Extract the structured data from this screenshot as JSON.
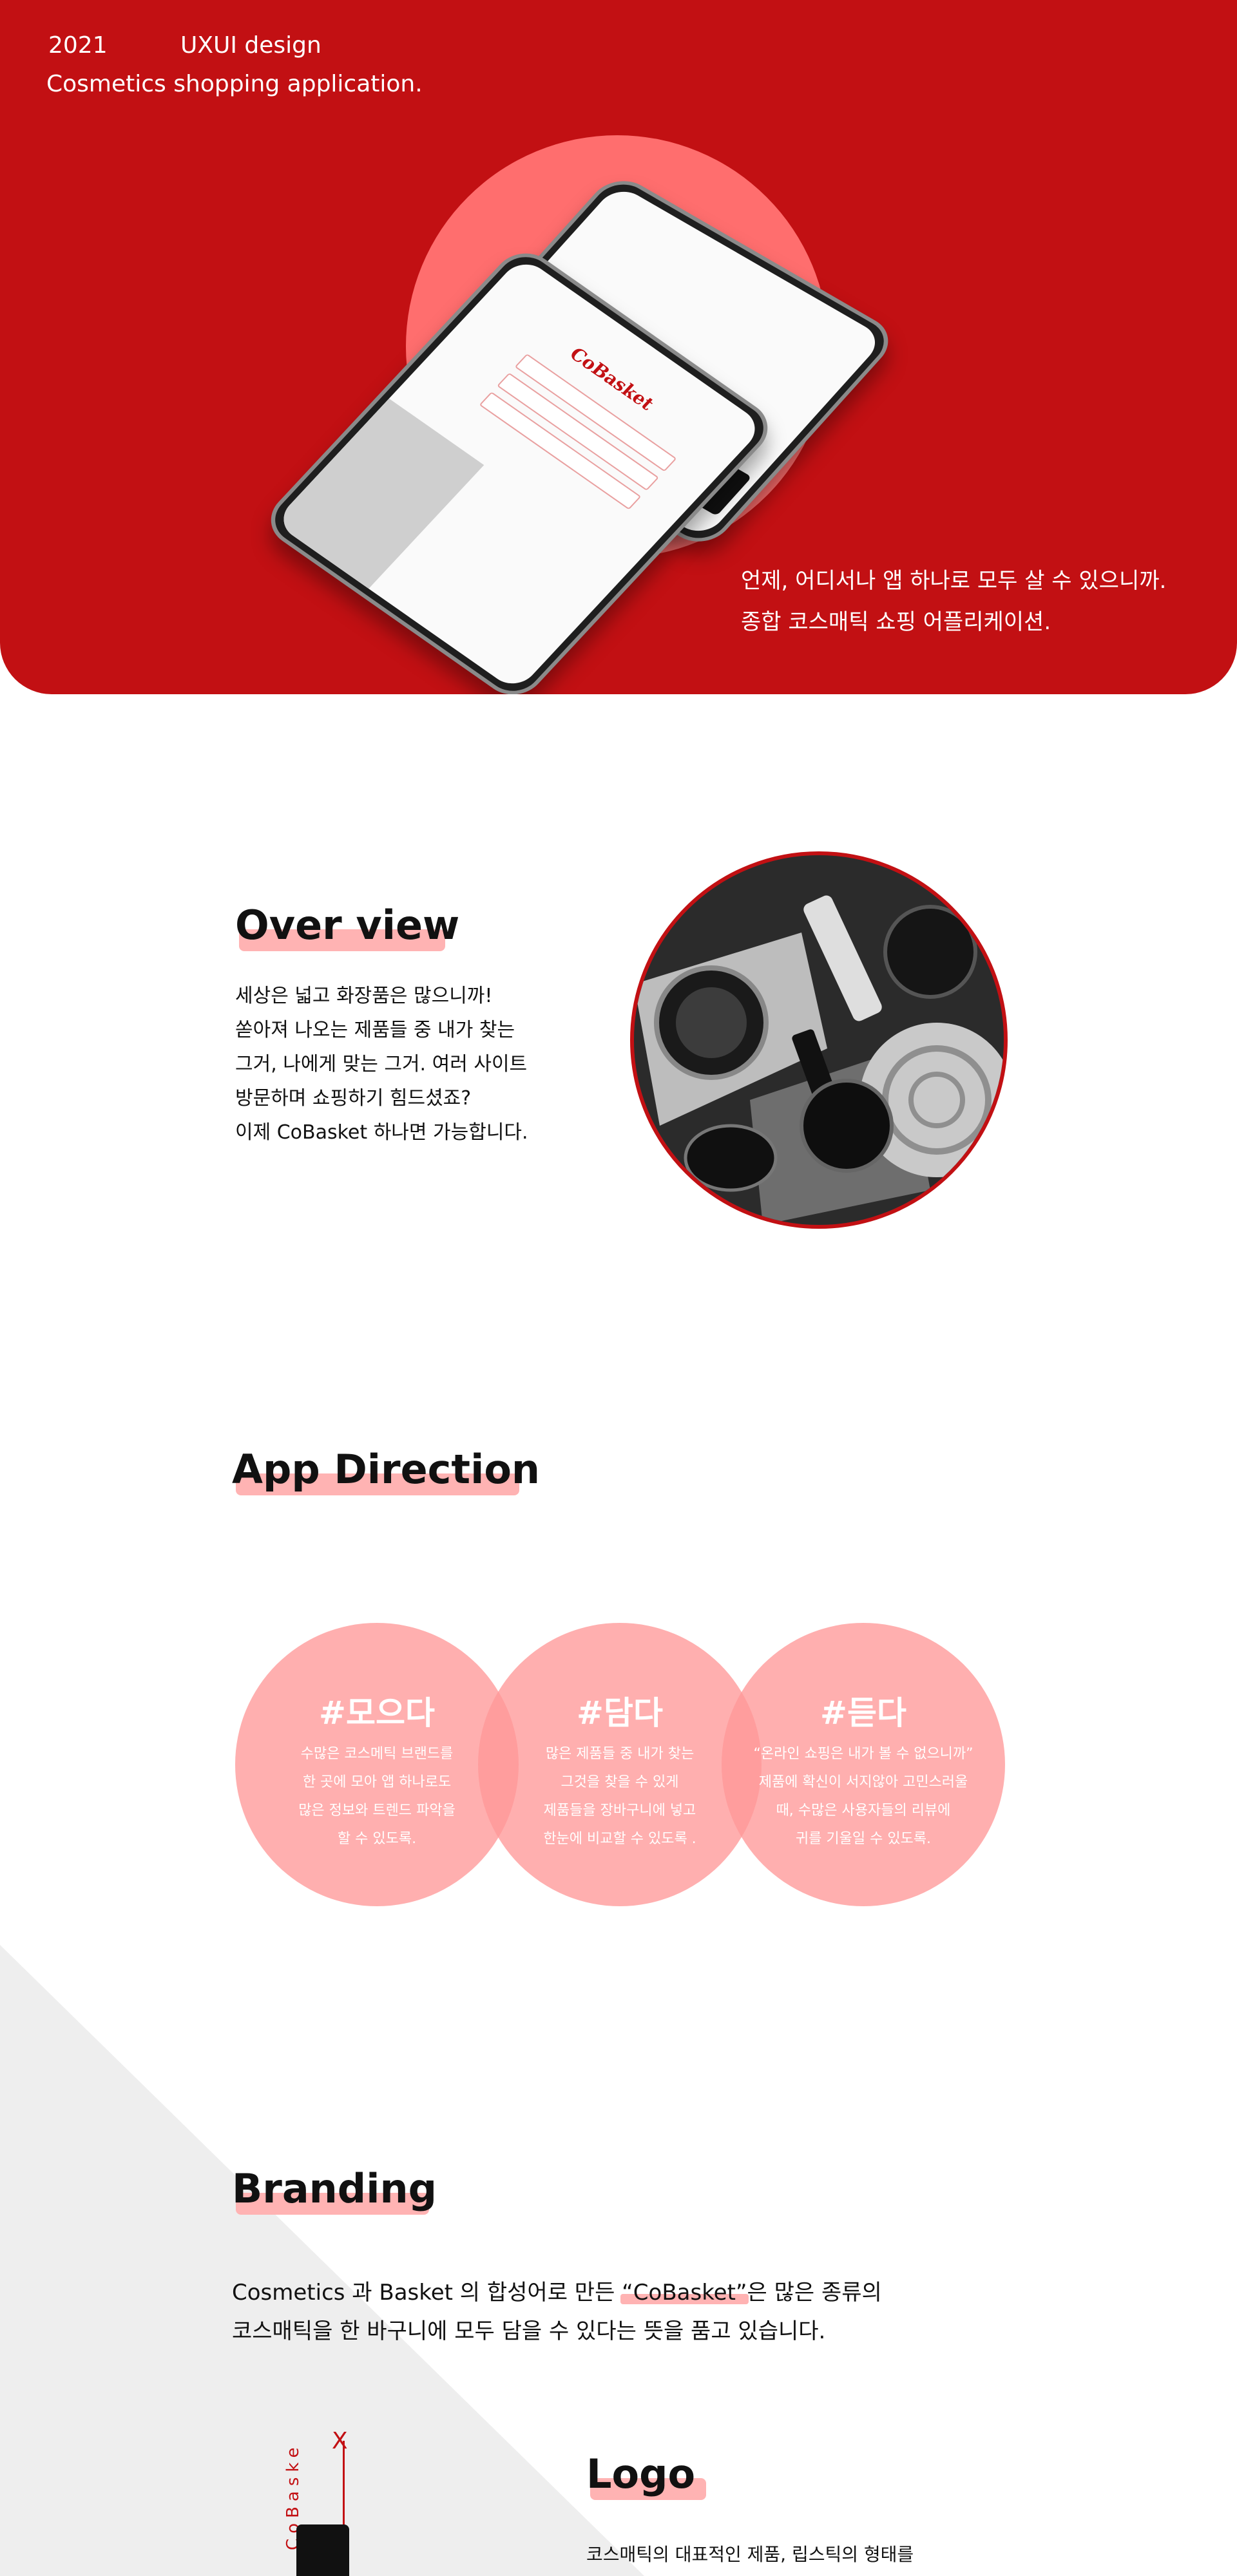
{
  "hero": {
    "year": "2021",
    "tag": "UXUI design",
    "subtitle": "Cosmetics shopping application.",
    "tagline_lines": [
      "언제, 어디서나 앱 하나로 모두 살 수 있으니까.",
      "종합 코스매틱 쇼핑 어플리케이션."
    ],
    "phone_brand": "CoBasket"
  },
  "overview": {
    "heading": "Over view",
    "lines": [
      "세상은 넓고 화장품은 많으니까!",
      "쏟아져 나오는 제품들 중 내가 찾는",
      "그거, 나에게 맞는 그거. 여러 사이트",
      "방문하며 쇼핑하기 힘드셨죠?",
      "이제 CoBasket 하나면 가능합니다."
    ]
  },
  "direction": {
    "heading": "App Direction",
    "items": [
      {
        "title": "#모으다",
        "lines": [
          "수많은 코스메틱 브랜드를",
          "한 곳에 모아 앱 하나로도",
          "많은 정보와 트렌드 파악을",
          "할 수 있도록."
        ]
      },
      {
        "title": "#담다",
        "lines": [
          "많은 제품들 중 내가 찾는",
          "그것을 찾을 수 있게",
          "제품들을 장바구니에 넣고",
          "한눈에 비교할 수 있도록 ."
        ]
      },
      {
        "title": "#듣다",
        "lines": [
          "“온라인 쇼핑은 내가 볼 수 없으니까”",
          "제품에 확신이 서지않아 고민스러울",
          "때, 수많은 사용자들의 리뷰에",
          "귀를 기울일 수 있도록."
        ]
      }
    ]
  },
  "branding": {
    "heading": "Branding",
    "line1_pre": "Cosmetics 과 Basket 의 합성어로 만든 ",
    "line1_quote": "“CoBasket”",
    "line1_post": "은 많은 종류의",
    "line2": "코스매틱을 한 바구니에 모두 담을 수 있다는 뜻을 품고 있습니다."
  },
  "logo": {
    "heading": "Logo",
    "vertical_text": "CoBaske",
    "mark": "X",
    "description": "코스매틱의 대표적인 제품, 립스틱의 형태를"
  },
  "colors": {
    "primary_red": "#c21013",
    "hero_circle": "#ff6e6e",
    "pink_circle": "#ff9999",
    "highlight": "#ffb3b3"
  }
}
